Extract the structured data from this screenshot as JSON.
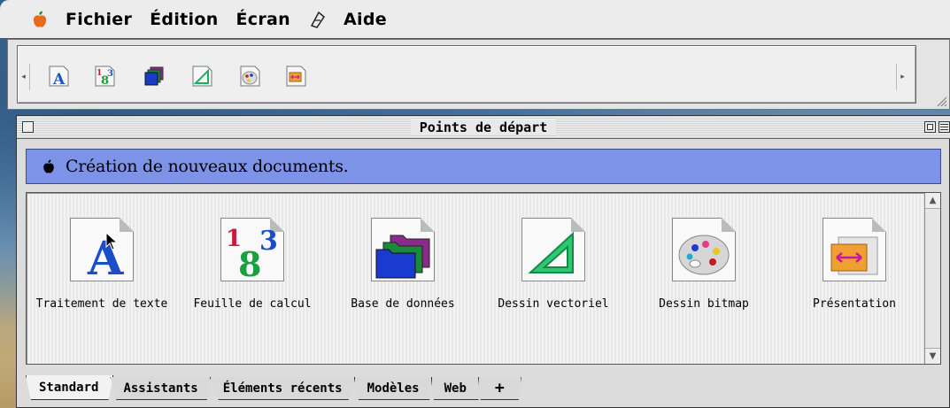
{
  "menubar": {
    "items": [
      "Fichier",
      "Édition",
      "Écran",
      "Aide"
    ]
  },
  "window": {
    "title": "Points de départ",
    "banner_text": "Création de nouveaux documents."
  },
  "documents": [
    {
      "label": "Traitement de texte",
      "icon": "word-processing-icon"
    },
    {
      "label": "Feuille de calcul",
      "icon": "spreadsheet-icon"
    },
    {
      "label": "Base de données",
      "icon": "database-icon"
    },
    {
      "label": "Dessin vectoriel",
      "icon": "drawing-icon"
    },
    {
      "label": "Dessin bitmap",
      "icon": "painting-icon"
    },
    {
      "label": "Présentation",
      "icon": "presentation-icon"
    }
  ],
  "tabs": [
    {
      "label": "Standard",
      "active": true
    },
    {
      "label": "Assistants",
      "active": false
    },
    {
      "label": "Éléments récents",
      "active": false
    },
    {
      "label": "Modèles",
      "active": false
    },
    {
      "label": "Web",
      "active": false
    },
    {
      "label": "+",
      "active": false
    }
  ],
  "colors": {
    "banner": "#7d93e8",
    "apple_logo": "#e86a1a"
  }
}
